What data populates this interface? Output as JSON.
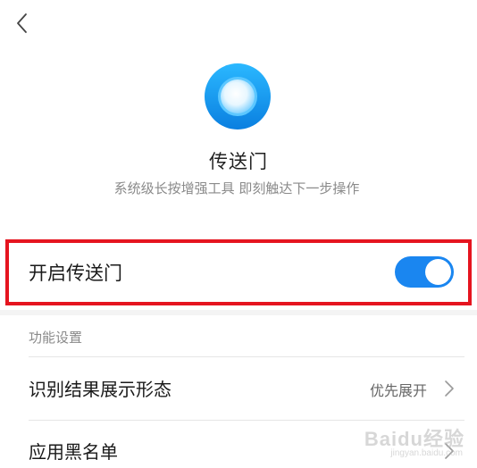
{
  "header": {
    "back_icon": "chevron-left-icon"
  },
  "app": {
    "icon": "portal-circle-icon",
    "title": "传送门",
    "subtitle": "系统级长按增强工具 即刻触达下一步操作"
  },
  "main_toggle": {
    "label": "开启传送门",
    "enabled": true,
    "highlight_color": "#e5141f",
    "switch_color": "#1a86f0"
  },
  "settings": {
    "section_title": "功能设置",
    "rows": [
      {
        "label": "识别结果展示形态",
        "value": "优先展开",
        "chevron_icon": "chevron-right-icon"
      },
      {
        "label": "应用黑名单",
        "value": "",
        "chevron_icon": "chevron-right-icon"
      }
    ]
  },
  "watermark": {
    "text": "Baidu经验",
    "sub": "jingyan.baidu.com"
  }
}
